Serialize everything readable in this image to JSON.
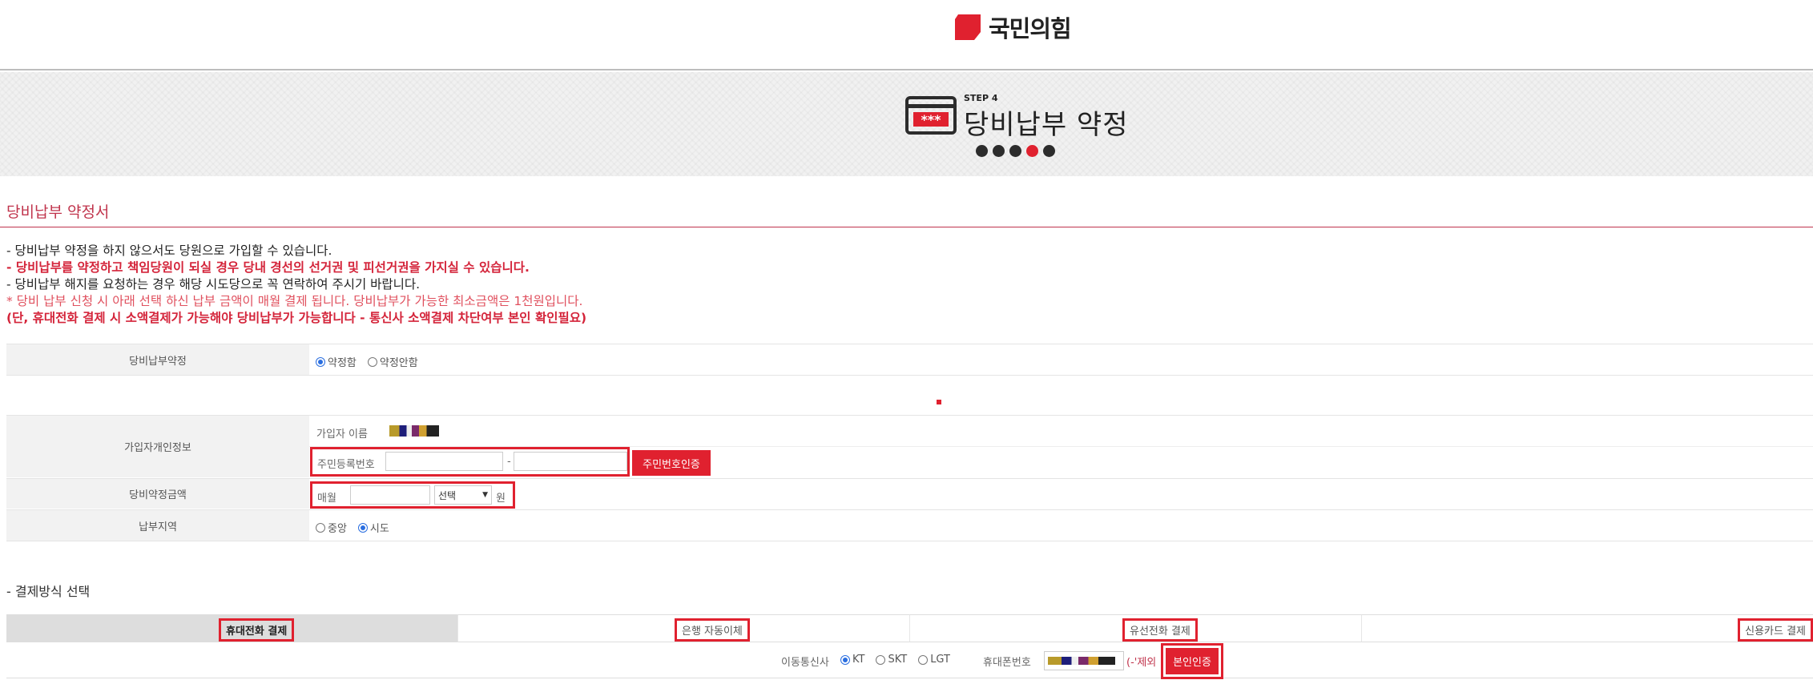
{
  "header": {
    "logo_text": "국민의힘"
  },
  "banner": {
    "step_label": "STEP 4",
    "title": "당비납부 약정",
    "icon_text": "***",
    "steps_total": 5,
    "steps_active": 4
  },
  "section": {
    "title": "당비납부 약정서"
  },
  "notices": [
    {
      "text": "- 당비납부 약정을 하지 않으서도 당원으로 가입할 수 있습니다.",
      "style": "normal"
    },
    {
      "text": "- 당비납부를 약정하고 책임당원이 되실 경우 당내 경선의 선거권 및 피선거권을 가지실 수 있습니다.",
      "style": "strong"
    },
    {
      "text": "- 당비납부 해지를 요청하는 경우 해당 시도당으로 꼭 연락하여 주시기 바랍니다.",
      "style": "normal"
    },
    {
      "text": "* 당비 납부 신청 시 아래 선택 하신 납부 금액이 매월 결제 됩니다. 당비납부가 가능한 최소금액은 1천원입니다.",
      "style": "light"
    },
    {
      "text": "(단, 휴대전화 결제 시 소액결제가 가능해야 당비납부가 가능합니다 - 통신사 소액결제 차단여부 본인 확인필요)",
      "style": "strong"
    }
  ],
  "pledge": {
    "label": "당비납부약정",
    "options": [
      "약정함",
      "약정안함"
    ],
    "selected": 0
  },
  "personal": {
    "label": "가입자개인정보",
    "name_label": "가입자 이름",
    "rrn_label": "주민등록번호",
    "rrn_separator": "-",
    "rrn_button": "주민번호인증"
  },
  "amount": {
    "label": "당비약정금액",
    "prefix": "매월",
    "select_value": "선택",
    "suffix": "원"
  },
  "region": {
    "label": "납부지역",
    "options": [
      "중앙",
      "시도"
    ],
    "selected": 1
  },
  "payment": {
    "title": "- 결제방식 선택",
    "tabs": [
      "휴대전화 결제",
      "은행 자동이체",
      "유선전화 결제",
      "신용카드 결제"
    ],
    "active_tab": 0,
    "carrier_label": "이동통신사",
    "carriers": [
      "KT",
      "SKT",
      "LGT"
    ],
    "carrier_selected": 0,
    "phone_label": "휴대폰번호",
    "phone_note": "(-'제외",
    "verify_button": "본인인증"
  },
  "colors": {
    "brand": "#e0212f",
    "accent_text": "#c0344c"
  }
}
